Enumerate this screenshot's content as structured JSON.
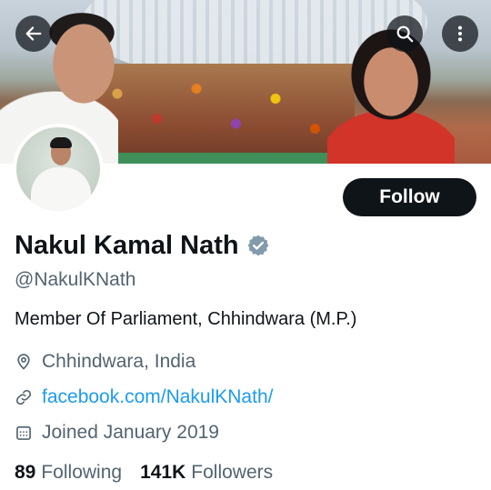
{
  "header": {
    "back_icon": "arrow-left-icon",
    "search_icon": "search-icon",
    "more_icon": "more-vertical-icon"
  },
  "profile": {
    "follow_label": "Follow",
    "name": "Nakul Kamal Nath",
    "verified_icon": "verified-badge-icon",
    "handle": "@NakulKNath",
    "bio": "Member Of Parliament, Chhindwara (M.P.)",
    "location": "Chhindwara, India",
    "location_icon": "location-pin-icon",
    "website": "facebook.com/NakulKNath/",
    "website_icon": "link-icon",
    "joined": "Joined January 2019",
    "joined_icon": "calendar-icon"
  },
  "stats": {
    "following_count": "89",
    "following_label": "Following",
    "followers_count": "141K",
    "followers_label": "Followers"
  },
  "colors": {
    "text_primary": "#0f1419",
    "text_secondary": "#536471",
    "link": "#1d9bf0",
    "verified_badge": "#829aab",
    "button_bg": "#0f1419"
  }
}
